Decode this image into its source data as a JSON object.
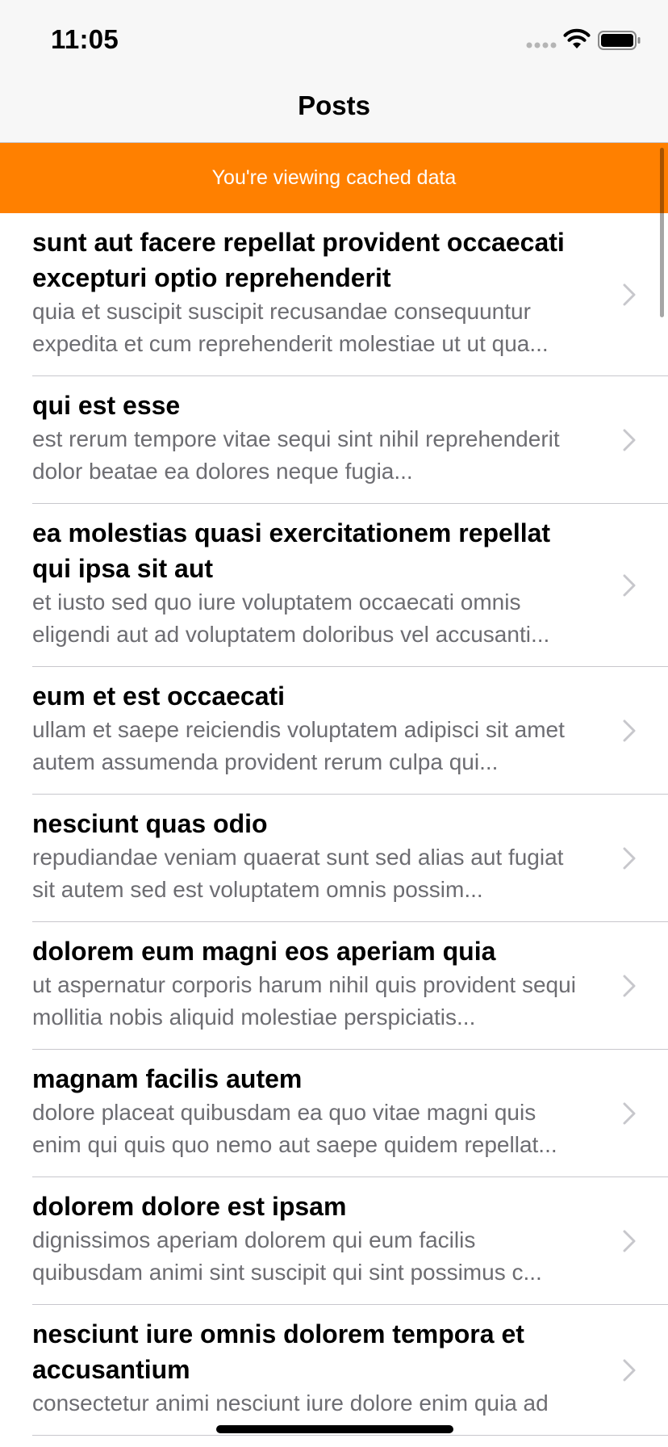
{
  "status_bar": {
    "time": "11:05"
  },
  "nav": {
    "title": "Posts"
  },
  "banner": {
    "text": "You're viewing cached data"
  },
  "posts": [
    {
      "title": "sunt aut facere repellat provident occaecati excepturi optio reprehenderit",
      "body": "quia et suscipit suscipit recusandae consequuntur expedita et cum reprehenderit molestiae ut ut qua..."
    },
    {
      "title": "qui est esse",
      "body": "est rerum tempore vitae sequi sint nihil reprehenderit dolor beatae ea dolores neque fugia..."
    },
    {
      "title": "ea molestias quasi exercitationem repellat qui ipsa sit aut",
      "body": "et iusto sed quo iure voluptatem occaecati omnis eligendi aut ad voluptatem doloribus vel accusanti..."
    },
    {
      "title": "eum et est occaecati",
      "body": "ullam et saepe reiciendis voluptatem adipisci sit amet autem assumenda provident rerum culpa qui..."
    },
    {
      "title": "nesciunt quas odio",
      "body": "repudiandae veniam quaerat sunt sed alias aut fugiat sit autem sed est voluptatem omnis possim..."
    },
    {
      "title": "dolorem eum magni eos aperiam quia",
      "body": "ut aspernatur corporis harum nihil quis provident sequi mollitia nobis aliquid molestiae perspiciatis..."
    },
    {
      "title": "magnam facilis autem",
      "body": "dolore placeat quibusdam ea quo vitae magni quis enim qui quis quo nemo aut saepe quidem repellat..."
    },
    {
      "title": "dolorem dolore est ipsam",
      "body": "dignissimos aperiam dolorem qui eum facilis quibusdam animi sint suscipit qui sint possimus c..."
    },
    {
      "title": "nesciunt iure omnis dolorem tempora et accusantium",
      "body": "consectetur animi nesciunt iure dolore enim quia ad"
    }
  ],
  "icons": {
    "signal": "signal-icon",
    "wifi": "wifi-icon",
    "battery": "battery-icon",
    "chevron": "chevron-right-icon"
  },
  "colors": {
    "banner": "#ff8000",
    "bar_background": "#f7f7f7",
    "secondary_text": "#6d6d72",
    "separator": "#c8c7cc",
    "chevron": "#c7c7cc"
  }
}
